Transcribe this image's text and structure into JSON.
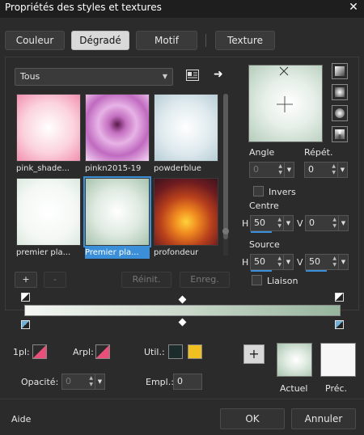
{
  "window": {
    "title": "Propriétés des styles et textures",
    "close_glyph": "✕"
  },
  "tabs": [
    {
      "label": "Couleur",
      "active": false
    },
    {
      "label": "Dégradé",
      "active": true
    },
    {
      "label": "Motif",
      "active": false
    },
    {
      "label": "Texture",
      "active": false
    }
  ],
  "category": {
    "selected": "Tous"
  },
  "gallery": {
    "items": [
      {
        "label": "pink_shade...",
        "selected": false
      },
      {
        "label": "pinkn2015-19",
        "selected": false
      },
      {
        "label": "powderblue",
        "selected": false
      },
      {
        "label": "premier pla...",
        "selected": false
      },
      {
        "label": "Premier pla...",
        "selected": true
      },
      {
        "label": "profondeur",
        "selected": false
      }
    ],
    "add_label": "+",
    "remove_label": "-",
    "reset_label": "Réinit.",
    "save_label": "Enreg."
  },
  "properties": {
    "angle_label": "Angle",
    "angle_value": "0",
    "repeat_label": "Répét.",
    "repeat_value": "0",
    "invert_label": "Invers",
    "center_label": "Centre",
    "center_h_label": "H",
    "center_h_value": "50",
    "center_v_label": "V",
    "center_v_value": "0",
    "source_label": "Source",
    "source_h_label": "H",
    "source_h_value": "50",
    "source_v_label": "V",
    "source_v_value": "50",
    "link_label": "Liaison"
  },
  "gradient": {
    "start_color": "#f4f6f4",
    "mid_color": "#cfdccf",
    "end_color": "#97b59d"
  },
  "bottom": {
    "foreground_label": "1pl:",
    "background_label": "Arpl:",
    "use_label": "Util.:",
    "opacity_label": "Opacité:",
    "opacity_value": "0",
    "location_label": "Empl.:",
    "location_value": "0",
    "current_label": "Actuel",
    "previous_label": "Préc.",
    "add_glyph": "+",
    "user_color_1": "#1c2b2b",
    "user_color_2": "#f0c020"
  },
  "footer": {
    "help_label": "Aide",
    "ok_label": "OK",
    "cancel_label": "Annuler"
  },
  "colors": {
    "accent": "#3a8fd8",
    "background": "#2b2b2b"
  }
}
